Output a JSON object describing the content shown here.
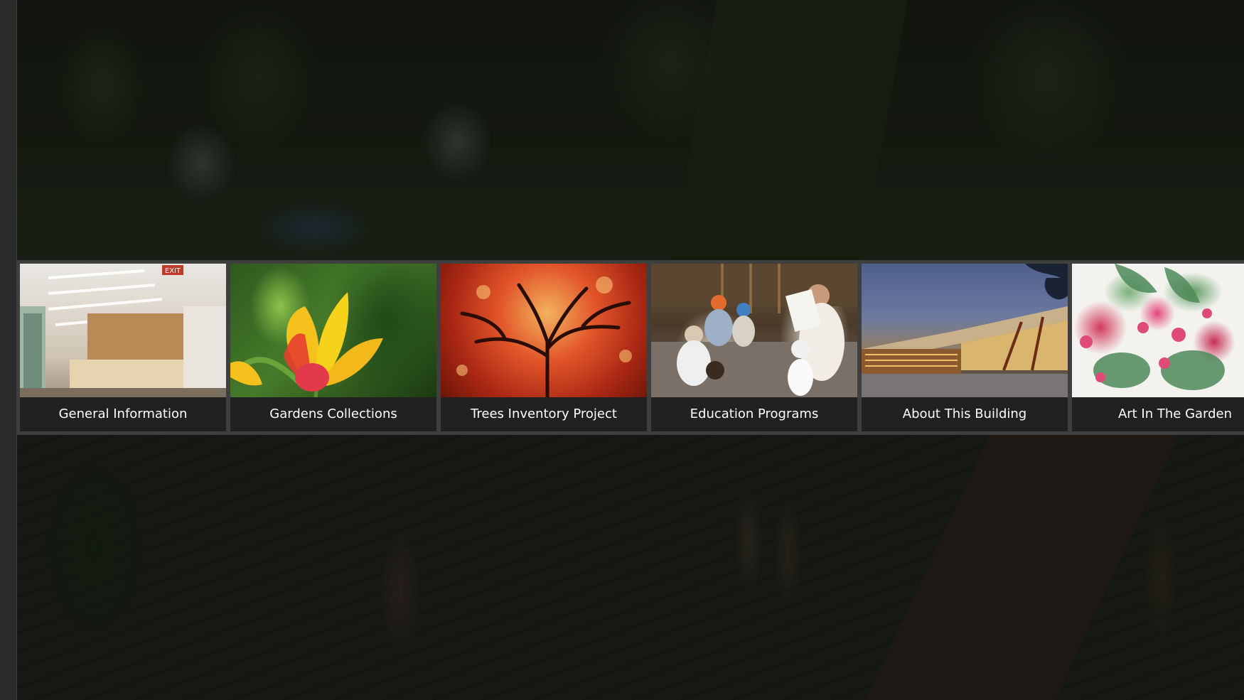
{
  "tiles": [
    {
      "label": "General Information"
    },
    {
      "label": "Gardens Collections"
    },
    {
      "label": "Trees Inventory Project"
    },
    {
      "label": "Education Programs"
    },
    {
      "label": "About This Building"
    },
    {
      "label": "Art In The Garden"
    }
  ],
  "signage": {
    "exit_sign": "EXIT"
  },
  "colors": {
    "caption_bar": "#1e1e1e",
    "strip_band": "#3f3f3f",
    "caption_text": "#ffffff"
  }
}
